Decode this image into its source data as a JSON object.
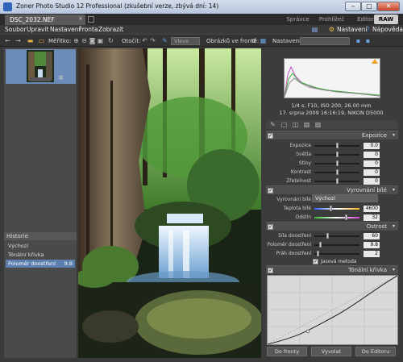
{
  "window": {
    "title": "Zoner Photo Studio 12 Professional (zkušební verze, zbývá dní: 14)",
    "minimize": "‒",
    "maximize": "□",
    "close": "✕"
  },
  "tabs": {
    "document": "DSC_2032.NEF",
    "close": "×",
    "modes": [
      "Správce",
      "Prohlížeč",
      "Editor",
      "RAW"
    ]
  },
  "menu": {
    "items": [
      "Soubor",
      "Upravit",
      "Nastavení",
      "Fronta",
      "Zobrazit"
    ],
    "right": [
      "Nastavení",
      "Nápověda"
    ]
  },
  "toolbar": {
    "scale_label": "Měřítko:",
    "rotate_label": "Otočit:",
    "white_placeholder": "Vlevo",
    "queue_label": "Obrázků ve frontě:",
    "queue_count": "0",
    "settings_label": "Nastavení:"
  },
  "history": {
    "title": "Historie",
    "items": [
      {
        "label": "Výchozí",
        "value": ""
      },
      {
        "label": "Tónální křivka",
        "value": ""
      },
      {
        "label": "Poloměr doostření",
        "value": "9.8"
      }
    ]
  },
  "info": {
    "exposure": "1/4 s, F10, ISO 200, 26.00 mm",
    "date_camera": "17. srpna 2009 16:16:19, NIKON D5000"
  },
  "expozice": {
    "title": "Expozice",
    "rows": [
      {
        "label": "Expozice",
        "value": "0.0"
      },
      {
        "label": "Světla",
        "value": "0"
      },
      {
        "label": "Stíny",
        "value": "0"
      },
      {
        "label": "Kontrast",
        "value": "0"
      },
      {
        "label": "Zřetelnost",
        "value": "0"
      }
    ]
  },
  "wb": {
    "title": "Vyrovnání bílé",
    "mode_label": "Vyrovnání bílé",
    "mode_value": "Výchozí",
    "temp_label": "Teplota bílé",
    "temp_value": "4600",
    "tint_label": "Odstín",
    "tint_value": "32"
  },
  "ostrost": {
    "title": "Ostrost",
    "rows": [
      {
        "label": "Síla doostření",
        "value": "60"
      },
      {
        "label": "Poloměr doostření",
        "value": "9.8"
      },
      {
        "label": "Práh doostření",
        "value": "2"
      }
    ],
    "checkbox_label": "Jasová metoda"
  },
  "curve": {
    "title": "Tónální křivka"
  },
  "bottom": {
    "queue": "Do fronty",
    "develop": "Vyvolat",
    "editor": "Do Editoru"
  }
}
